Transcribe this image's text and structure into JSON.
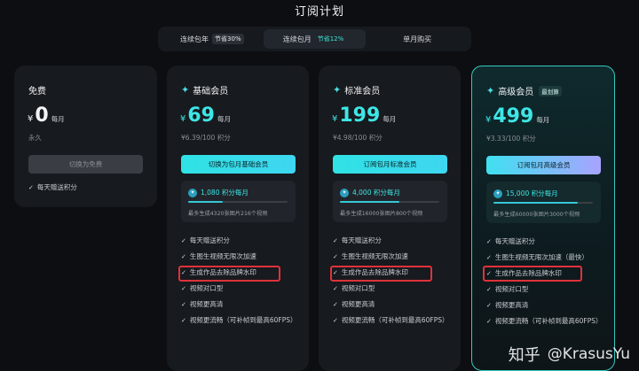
{
  "page_title": "订阅计划",
  "billing_toggle": [
    {
      "label": "连续包年",
      "badge": "节省30%",
      "active": false
    },
    {
      "label": "连续包月",
      "badge": "节省12%",
      "active": true
    },
    {
      "label": "单月购买",
      "badge": "",
      "active": false
    }
  ],
  "plans": {
    "free": {
      "name": "免费",
      "currency": "¥",
      "amount": "0",
      "per": "每月",
      "sub": "永久",
      "button": "切换为免费",
      "features": [
        "每天赠送积分"
      ]
    },
    "basic": {
      "name": "基础会员",
      "currency": "¥",
      "amount": "69",
      "per": "每月",
      "sub": "¥6.39/100 积分",
      "button": "切换为包月基础会员",
      "credits": "1,080 积分每月",
      "credit_note": "最多生成4320张图片216个视频",
      "progress": 0.35,
      "features": [
        "每天赠送积分",
        "生图生视频无限次加速",
        "生成作品去除品牌水印",
        "视频对口型",
        "视频更高清",
        "视频更流畅（可补帧到最高60FPS）"
      ]
    },
    "standard": {
      "name": "标准会员",
      "currency": "¥",
      "amount": "199",
      "per": "每月",
      "sub": "¥4.98/100 积分",
      "button": "订阅包月标准会员",
      "credits": "4,000 积分每月",
      "credit_note": "最多生成16000张图片800个视频",
      "progress": 0.6,
      "features": [
        "每天赠送积分",
        "生图生视频无限次加速",
        "生成作品去除品牌水印",
        "视频对口型",
        "视频更高清",
        "视频更流畅（可补帧到最高60FPS）"
      ]
    },
    "premium": {
      "name": "高级会员",
      "badge": "最划算",
      "currency": "¥",
      "amount": "499",
      "per": "每月",
      "sub": "¥3.33/100 积分",
      "button": "订阅包月高级会员",
      "credits": "15,000 积分每月",
      "credit_note": "最多生成60000张图片3000个视频",
      "progress": 0.85,
      "features": [
        "每天赠送积分",
        "生图生视频无限次加速（最快）",
        "生成作品去除品牌水印",
        "视频对口型",
        "视频更高清",
        "视频更流畅（可补帧到最高60FPS）"
      ]
    }
  },
  "watermark": {
    "platform": "知乎",
    "user": "@KrasusYu"
  },
  "colors": {
    "accent": "#3ee6e6",
    "highlight_box": "#e0323a",
    "background": "#0c0e12"
  }
}
